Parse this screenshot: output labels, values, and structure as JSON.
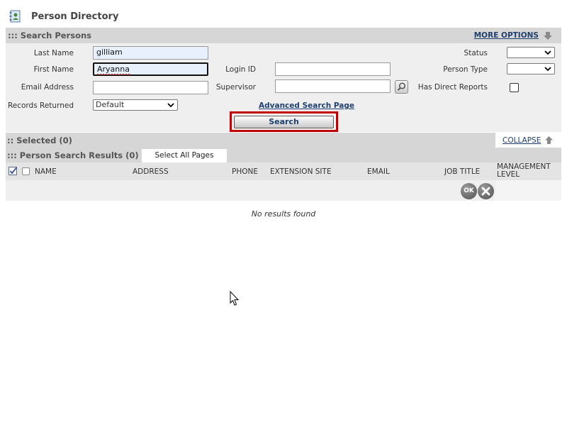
{
  "page": {
    "title": "Person Directory"
  },
  "search_section": {
    "title": "::: Search Persons",
    "more_options": "MORE OPTIONS",
    "fields": {
      "last_name_label": "Last Name",
      "last_name_value": "gilliam",
      "first_name_label": "First Name",
      "first_name_value": "Aryanna",
      "email_label": "Email Address",
      "email_value": "",
      "records_label": "Records Returned",
      "records_value": "Default",
      "login_label": "Login ID",
      "login_value": "",
      "supervisor_label": "Supervisor",
      "supervisor_value": "",
      "status_label": "Status",
      "status_value": "",
      "person_type_label": "Person Type",
      "person_type_value": "",
      "direct_reports_label": "Has Direct Reports",
      "direct_reports_checked": false
    },
    "advanced_link": "Advanced Search Page",
    "search_button": "Search"
  },
  "selected_section": {
    "title": ":: Selected (0)",
    "collapse": "COLLAPSE"
  },
  "results_section": {
    "title": "::: Person Search Results (0)",
    "select_all": "Select All Pages",
    "columns": [
      "NAME",
      "ADDRESS",
      "PHONE",
      "EXTENSION SITE",
      "EMAIL",
      "JOB TITLE",
      "MANAGEMENT LEVEL"
    ],
    "ok_button": "OK",
    "empty_message": "No results found"
  },
  "colors": {
    "section_header": "#d6d6d6",
    "panel": "#efefef",
    "link": "#1f3f6e",
    "highlight": "#c00000"
  },
  "icons": [
    "person-directory-icon",
    "down-arrow-icon",
    "chevron-down-icon",
    "magnifier-icon",
    "up-arrow-icon",
    "checkbox-checked-icon",
    "close-icon",
    "mouse-cursor-icon"
  ]
}
